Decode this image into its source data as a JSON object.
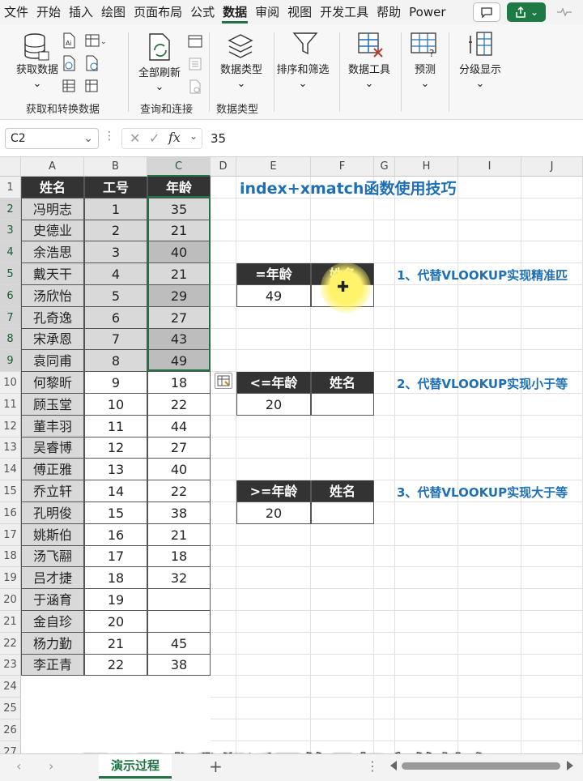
{
  "menu": [
    "文件",
    "开始",
    "插入",
    "绘图",
    "页面布局",
    "公式",
    "数据",
    "审阅",
    "视图",
    "开发工具",
    "帮助",
    "Power"
  ],
  "active_menu": "数据",
  "ribbon": {
    "get_data": "获取数据",
    "group1": "获取和转换数据",
    "refresh_all": "全部刷新",
    "group2": "查询和连接",
    "data_types": "数据类型",
    "group3": "数据类型",
    "sort_filter": "排序和筛选",
    "data_tools": "数据工具",
    "forecast": "预测",
    "outline": "分级显示"
  },
  "name_box": "C2",
  "formula_value": "35",
  "columns": [
    "A",
    "B",
    "C",
    "D",
    "E",
    "F",
    "G",
    "H",
    "I",
    "J"
  ],
  "rows": [
    "1",
    "2",
    "3",
    "4",
    "5",
    "6",
    "7",
    "8",
    "9",
    "10",
    "11",
    "12",
    "13",
    "14",
    "15",
    "16",
    "17",
    "18",
    "19",
    "20",
    "21",
    "22",
    "23",
    "24",
    "25",
    "26",
    "27"
  ],
  "table": {
    "headers": [
      "姓名",
      "工号",
      "年龄"
    ],
    "rows": [
      [
        "冯明志",
        "1",
        "35"
      ],
      [
        "史德业",
        "2",
        "21"
      ],
      [
        "余浩思",
        "3",
        "40"
      ],
      [
        "戴天干",
        "4",
        "21"
      ],
      [
        "汤欣怡",
        "5",
        "29"
      ],
      [
        "孔奇逸",
        "6",
        "27"
      ],
      [
        "宋承恩",
        "7",
        "43"
      ],
      [
        "袁同甫",
        "8",
        "49"
      ],
      [
        "何黎昕",
        "9",
        "18"
      ],
      [
        "顾玉堂",
        "10",
        "22"
      ],
      [
        "董丰羽",
        "11",
        "44"
      ],
      [
        "吴睿博",
        "12",
        "27"
      ],
      [
        "傅正雅",
        "13",
        "40"
      ],
      [
        "乔立轩",
        "14",
        "22"
      ],
      [
        "孔明俊",
        "15",
        "38"
      ],
      [
        "姚斯伯",
        "16",
        "21"
      ],
      [
        "汤飞翮",
        "17",
        "18"
      ],
      [
        "吕才捷",
        "18",
        "32"
      ],
      [
        "于涵育",
        "19",
        ""
      ],
      [
        "金自珍",
        "20",
        ""
      ],
      [
        "杨力勤",
        "21",
        "45"
      ],
      [
        "李正青",
        "22",
        "38"
      ]
    ]
  },
  "sheet_title": "index+xmatch函数使用技巧",
  "lookups": [
    {
      "header_age": "=年龄",
      "header_name": "姓名",
      "value": "49",
      "tip": "1、代替VLOOKUP实现精准匹"
    },
    {
      "header_age": "<=年龄",
      "header_name": "姓名",
      "value": "20",
      "tip": "2、代替VLOOKUP实现小于等"
    },
    {
      "header_age": ">=年龄",
      "header_name": "姓名",
      "value": "20",
      "tip": "3、代替VLOOKUP实现大于等"
    }
  ],
  "caption": "题目要求我们返回的是相应的姓名",
  "sheet_tab": "演示过程",
  "colors": {
    "accent": "#217346",
    "title_blue": "#1f6fb5",
    "header_dark": "#333333",
    "shade": "#d9d9d9"
  }
}
